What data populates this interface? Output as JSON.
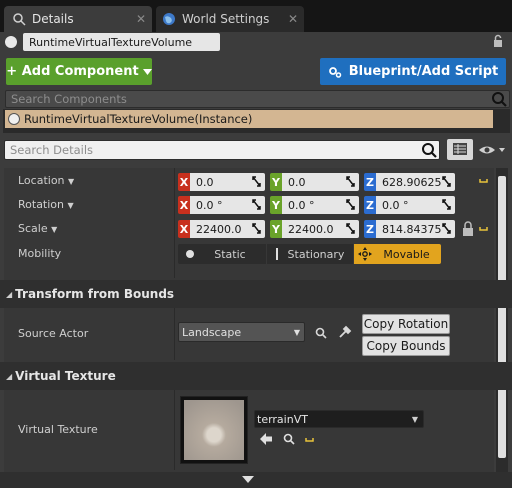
{
  "tabs": [
    {
      "label": "Details",
      "close": "✕"
    },
    {
      "label": "World Settings",
      "close": "✕"
    }
  ],
  "actor_name": "RuntimeVirtualTextureVolume",
  "toolbar": {
    "add_component": "+ Add Component",
    "blueprint": "Blueprint/Add Script"
  },
  "search_components_placeholder": "Search Components",
  "component_instance": "RuntimeVirtualTextureVolume(Instance)",
  "search_details_placeholder": "Search Details",
  "transform": {
    "location": {
      "label": "Location",
      "x": "0.0",
      "y": "0.0",
      "z": "628.90625"
    },
    "rotation": {
      "label": "Rotation",
      "x": "0.0 °",
      "y": "0.0 °",
      "z": "0.0 °"
    },
    "scale": {
      "label": "Scale",
      "x": "22400.0",
      "y": "22400.0",
      "z": "814.84375"
    },
    "mobility": {
      "label": "Mobility",
      "options": [
        "Static",
        "Stationary",
        "Movable"
      ],
      "selected": "Movable"
    }
  },
  "sections": {
    "transform_from_bounds": "Transform from Bounds",
    "virtual_texture": "Virtual Texture"
  },
  "source_actor": {
    "label": "Source Actor",
    "value": "Landscape",
    "copy_rotation": "Copy Rotation",
    "copy_bounds": "Copy Bounds"
  },
  "virtual_texture": {
    "label": "Virtual Texture",
    "asset": "terrainVT"
  },
  "colors": {
    "axis_x": "#c8301e",
    "axis_y": "#6aa32a",
    "axis_z": "#2b6cd0",
    "add_component": "#5aa02c",
    "blueprint": "#1f6fbf",
    "movable": "#e2a41e",
    "selected_component": "#d3b692"
  }
}
